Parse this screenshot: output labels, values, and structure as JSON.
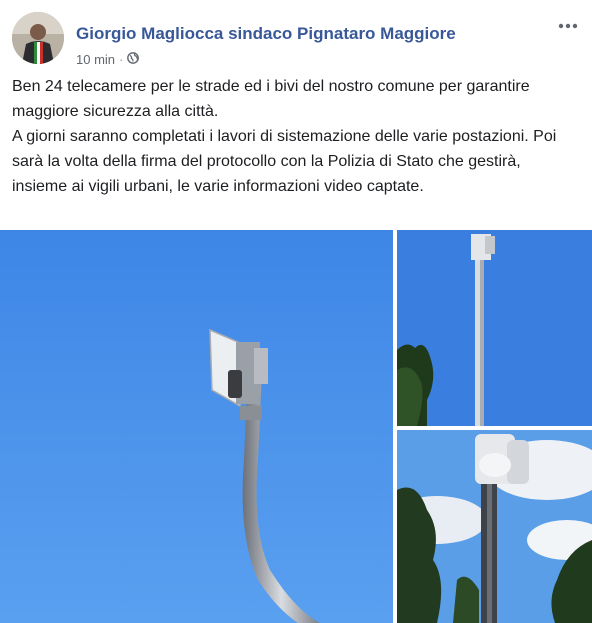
{
  "post": {
    "author": "Giorgio Magliocca sindaco Pignataro Maggiore",
    "time": "10 min",
    "separator": "·",
    "audience_icon": "globe-icon",
    "more_icon": "more-options-icon",
    "message": [
      "Ben 24 telecamere per le strade ed i bivi del nostro comune per garantire maggiore sicurezza alla città.",
      "A giorni saranno completati i lavori di sistemazione delle varie postazioni. Poi sarà la volta della firma del protocollo con la Polizia di Stato che gestirà, insieme ai vigili urbani, le varie informazioni video captate."
    ]
  },
  "colors": {
    "author": "#385898",
    "meta": "#616770",
    "sky": "#4a8fe8"
  }
}
